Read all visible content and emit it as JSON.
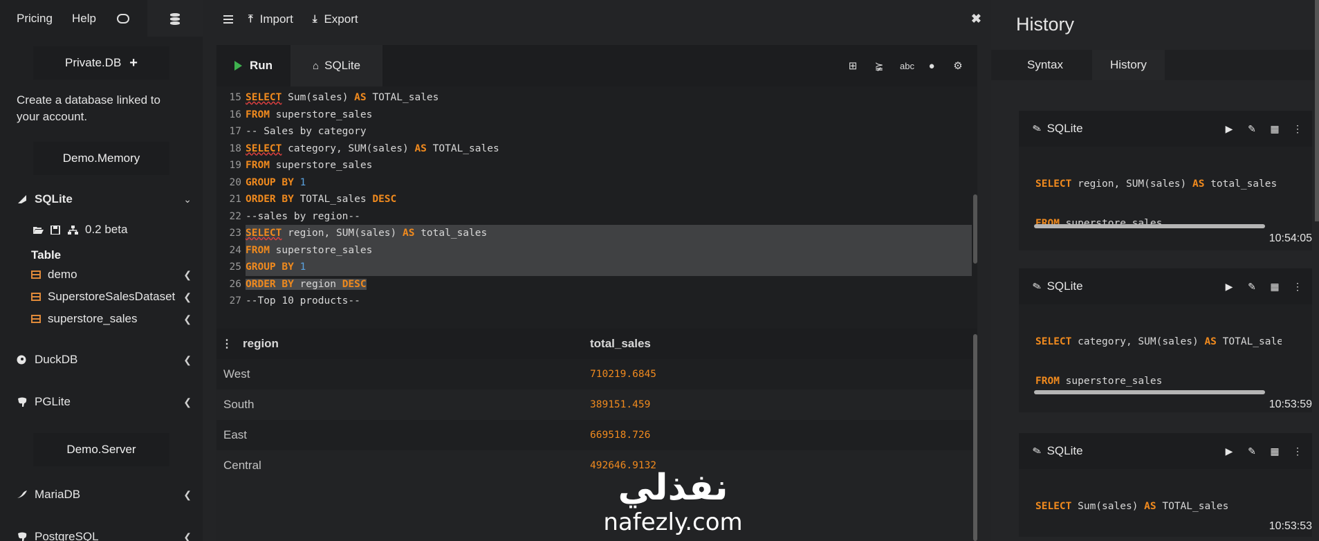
{
  "topbar": {
    "pricing": "Pricing",
    "help": "Help"
  },
  "sidebar": {
    "private_db": "Private.DB",
    "private_plus": "+",
    "description": "Create a database linked to your account.",
    "demo_memory": "Demo.Memory",
    "sqlite": "SQLite",
    "version": "0.2 beta",
    "table_label": "Table",
    "tables": [
      "demo",
      "SuperstoreSalesDataset",
      "superstore_sales"
    ],
    "duckdb": "DuckDB",
    "pglite": "PGLite",
    "demo_server": "Demo.Server",
    "mariadb": "MariaDB",
    "postgresql": "PostgreSQL"
  },
  "main": {
    "import": "Import",
    "export": "Export",
    "run": "Run",
    "tab": "SQLite"
  },
  "results": {
    "columns": [
      "region",
      "total_sales"
    ],
    "rows": [
      [
        "West",
        "710219.6845"
      ],
      [
        "South",
        "389151.459"
      ],
      [
        "East",
        "669518.726"
      ],
      [
        "Central",
        "492646.9132"
      ]
    ]
  },
  "watermark": {
    "arabic": "نفذلي",
    "latin": "nafezly.com"
  },
  "history": {
    "title": "History",
    "tabs": [
      "Syntax",
      "History"
    ],
    "cards": [
      {
        "engine": "SQLite",
        "time": "10:54:05"
      },
      {
        "engine": "SQLite",
        "time": "10:53:59"
      },
      {
        "engine": "SQLite",
        "time": "10:53:53"
      }
    ]
  },
  "colors": {
    "keyword": "#f08a1e",
    "number": "#5aa2e0",
    "run": "#3fb24f",
    "table_icon": "#e08a3a"
  }
}
